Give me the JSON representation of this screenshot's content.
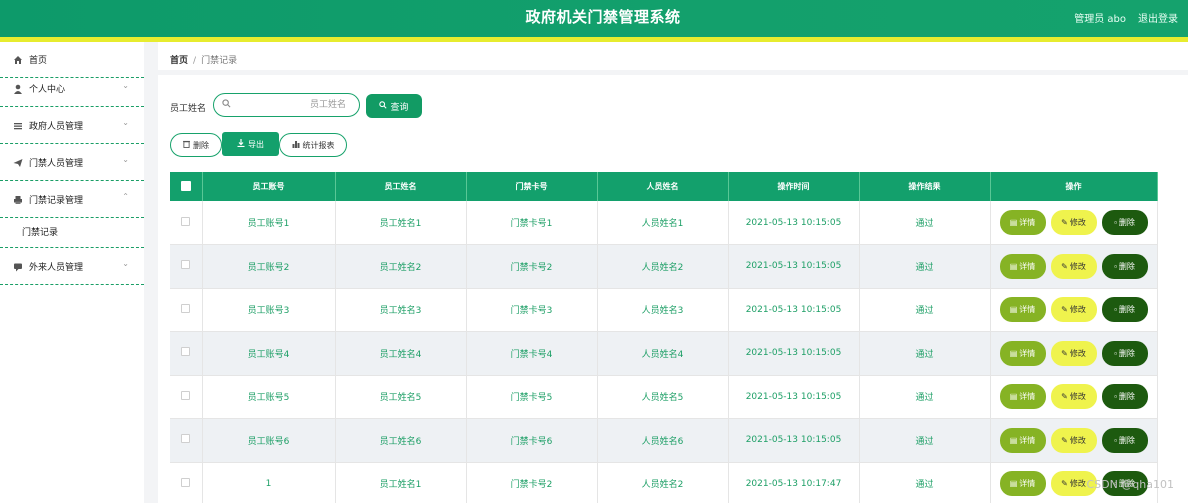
{
  "header": {
    "title": "政府机关门禁管理系统",
    "admin": "管理员 abo",
    "logout": "退出登录"
  },
  "sidebar": {
    "items": [
      {
        "label": "首页",
        "icon": "home-icon"
      },
      {
        "label": "个人中心",
        "icon": "user-icon"
      },
      {
        "label": "政府人员管理",
        "icon": "list-icon"
      },
      {
        "label": "门禁人员管理",
        "icon": "send-icon"
      },
      {
        "label": "门禁记录管理",
        "icon": "printer-icon"
      },
      {
        "label": "外来人员管理",
        "icon": "chat-icon"
      }
    ],
    "submenu": {
      "label": "门禁记录"
    }
  },
  "breadcrumb": {
    "home": "首页",
    "sep": "/",
    "current": "门禁记录"
  },
  "search": {
    "label": "员工姓名",
    "placeholder": "员工姓名",
    "button": "查询"
  },
  "actions": {
    "delete": "删除",
    "export": "导出",
    "stats": "统计报表"
  },
  "table": {
    "headers": [
      "员工账号",
      "员工姓名",
      "门禁卡号",
      "人员姓名",
      "操作时间",
      "操作结果",
      "操作"
    ],
    "rows": [
      {
        "account": "员工账号1",
        "name": "员工姓名1",
        "card": "门禁卡号1",
        "person": "人员姓名1",
        "time": "2021-05-13 10:15:05",
        "result": "通过"
      },
      {
        "account": "员工账号2",
        "name": "员工姓名2",
        "card": "门禁卡号2",
        "person": "人员姓名2",
        "time": "2021-05-13 10:15:05",
        "result": "通过"
      },
      {
        "account": "员工账号3",
        "name": "员工姓名3",
        "card": "门禁卡号3",
        "person": "人员姓名3",
        "time": "2021-05-13 10:15:05",
        "result": "通过"
      },
      {
        "account": "员工账号4",
        "name": "员工姓名4",
        "card": "门禁卡号4",
        "person": "人员姓名4",
        "time": "2021-05-13 10:15:05",
        "result": "通过"
      },
      {
        "account": "员工账号5",
        "name": "员工姓名5",
        "card": "门禁卡号5",
        "person": "人员姓名5",
        "time": "2021-05-13 10:15:05",
        "result": "通过"
      },
      {
        "account": "员工账号6",
        "name": "员工姓名6",
        "card": "门禁卡号6",
        "person": "人员姓名6",
        "time": "2021-05-13 10:15:05",
        "result": "通过"
      },
      {
        "account": "1",
        "name": "员工姓名1",
        "card": "门禁卡号2",
        "person": "人员姓名2",
        "time": "2021-05-13 10:17:47",
        "result": "通过"
      }
    ],
    "ops": {
      "detail": "详情",
      "edit": "修改",
      "delete": "删除"
    }
  },
  "watermark": "CSDN @qha101",
  "colors": {
    "primary": "#13a06c",
    "accent_bar": "#e7ec2f",
    "detail": "#86b324",
    "edit": "#eff34d",
    "delete": "#1d5a0f"
  }
}
